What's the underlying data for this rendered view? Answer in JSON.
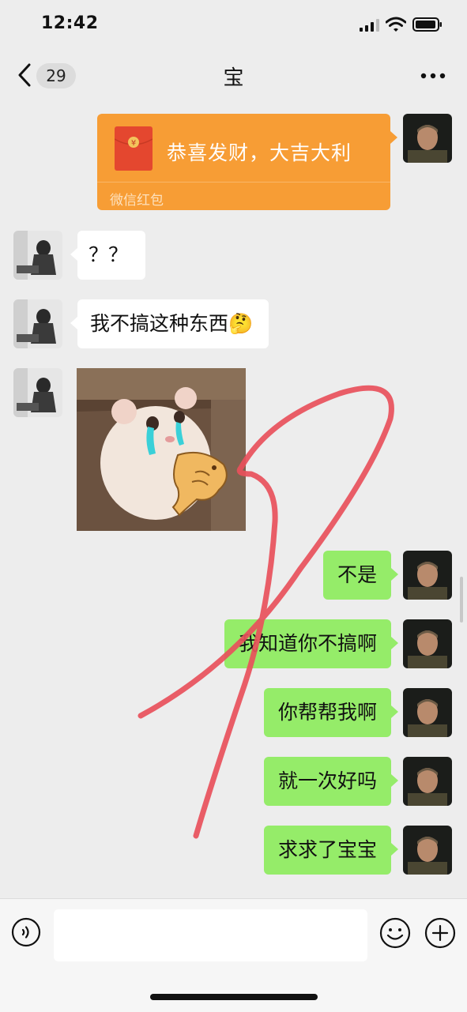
{
  "status_bar": {
    "time": "12:42"
  },
  "header": {
    "unread_count": "29",
    "title": "宝"
  },
  "red_packet": {
    "title": "恭喜发财，大吉大利",
    "label": "微信红包",
    "symbol": "¥"
  },
  "messages": [
    {
      "from": "contact",
      "text": "？？"
    },
    {
      "from": "contact",
      "text": "我不搞这种东西🤔"
    },
    {
      "from": "contact",
      "type": "sticker",
      "sticker": "crying-hamster-with-fish-cookie"
    },
    {
      "from": "me",
      "text": "不是"
    },
    {
      "from": "me",
      "text": "我知道你不搞啊"
    },
    {
      "from": "me",
      "text": "你帮帮我啊"
    },
    {
      "from": "me",
      "text": "就一次好吗"
    },
    {
      "from": "me",
      "text": "求求了宝宝"
    }
  ],
  "input": {
    "value": ""
  },
  "colors": {
    "background": "#ededed",
    "outgoing": "#95ec69",
    "incoming": "#ffffff",
    "red_packet": "#f79d35",
    "annotation": "#e8505b"
  },
  "icons": [
    "back-icon",
    "more-icon",
    "voice-icon",
    "emoji-icon",
    "plus-icon"
  ]
}
